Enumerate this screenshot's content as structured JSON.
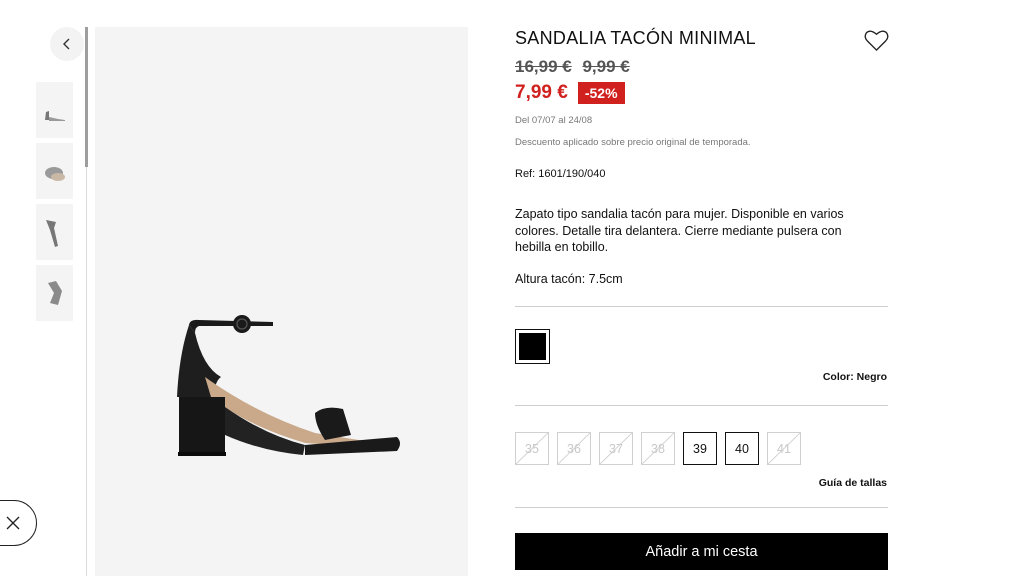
{
  "product": {
    "title": "SANDALIA TACÓN MINIMAL",
    "old_price_1": "16,99 €",
    "old_price_2": "9,99 €",
    "price": "7,99 €",
    "discount": "-52%",
    "dates": "Del 07/07 al 24/08",
    "disclaimer": "Descuento aplicado sobre precio original de temporada.",
    "ref": "Ref: 1601/190/040",
    "description": "Zapato tipo sandalia tacón para mujer. Disponible en varios colores. Detalle tira delantera. Cierre mediante pulsera con hebilla en tobillo.",
    "heel_height": "Altura tacón: 7.5cm"
  },
  "colors": {
    "selected_label": "Color: Negro",
    "swatch_hex": "#000000"
  },
  "sizes": [
    {
      "label": "35",
      "available": false
    },
    {
      "label": "36",
      "available": false
    },
    {
      "label": "37",
      "available": false
    },
    {
      "label": "38",
      "available": false
    },
    {
      "label": "39",
      "available": true
    },
    {
      "label": "40",
      "available": true
    },
    {
      "label": "41",
      "available": false
    }
  ],
  "size_guide": "Guía de tallas",
  "add_to_cart": "Añadir a mi cesta",
  "icons": {
    "back": "chevron-left-icon",
    "close": "close-icon",
    "wishlist": "heart-icon"
  },
  "theme": {
    "sale_red": "#d1211f",
    "image_bg": "#f4f4f4"
  }
}
